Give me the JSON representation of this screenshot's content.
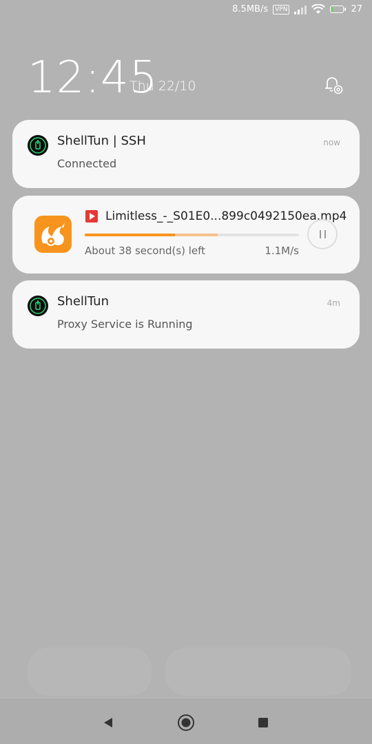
{
  "status_bar": {
    "net_speed": "8.5MB/s",
    "vpn": "VPN",
    "battery_level": "27",
    "battery_fraction": 0.27
  },
  "lockscreen": {
    "time": "12:45",
    "date": "Thu 22/10"
  },
  "notifications": [
    {
      "app_icon": "power-shield-icon",
      "title": "ShellTun | SSH",
      "text": "Connected",
      "time": "now"
    },
    {
      "app_icon": "uc-browser-icon",
      "file_icon": "video-file-icon",
      "file_name": "Limitless_-_S01E0...899c0492150ea.mp4",
      "progress": 0.42,
      "buffer": 0.62,
      "time_left": "About 38 second(s) left",
      "speed": "1.1M/s",
      "action_icon": "pause-icon"
    },
    {
      "app_icon": "power-shield-icon",
      "title": "ShellTun",
      "text": "Proxy Service is Running",
      "time": "4m"
    }
  ],
  "colors": {
    "accent": "#f7941d",
    "battery_charging": "#6fd16b",
    "shelltun_icon": "#2ed573"
  },
  "nav_bar": {
    "back_icon": "back-triangle-icon",
    "home_icon": "home-circle-icon",
    "recents_icon": "recents-square-icon"
  }
}
